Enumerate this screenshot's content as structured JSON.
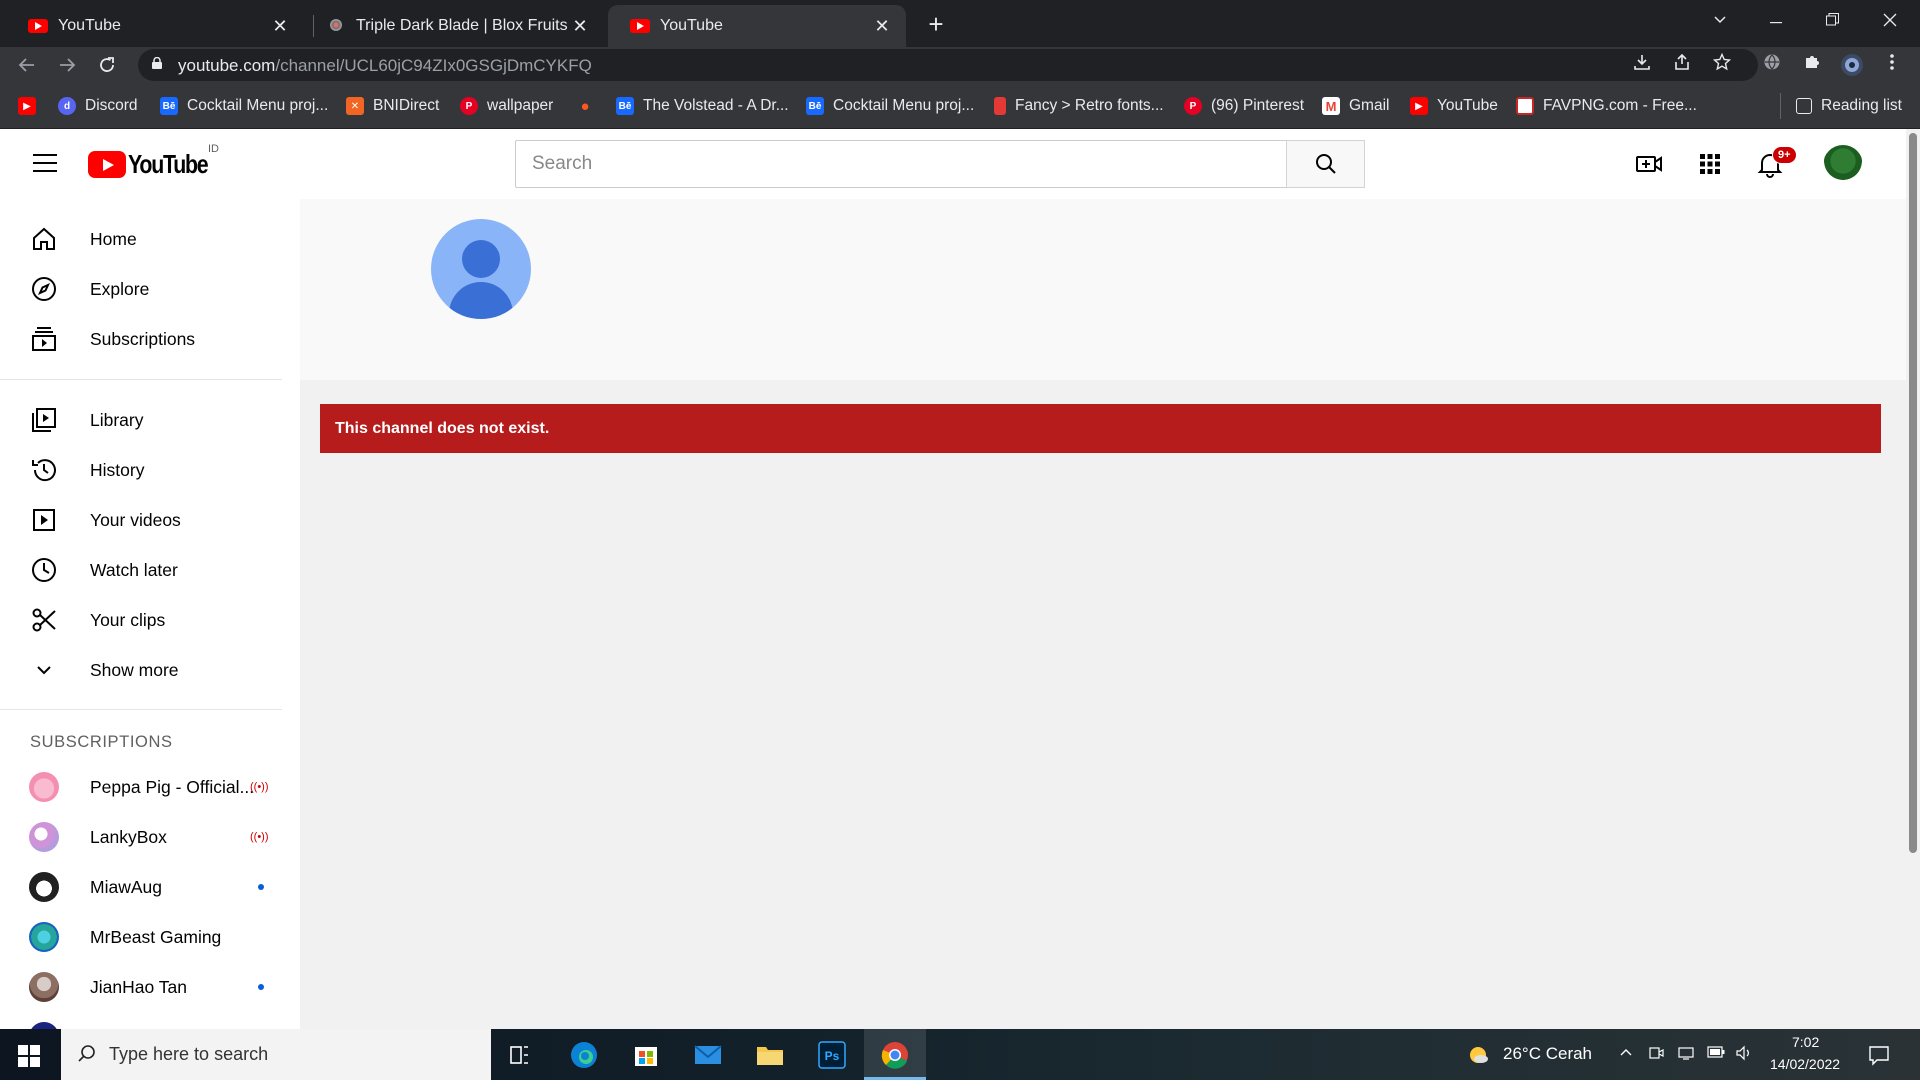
{
  "browser": {
    "tabs": [
      {
        "title": "YouTube",
        "icon": "youtube-icon"
      },
      {
        "title": "Triple Dark Blade | Blox Fruits Wiki",
        "icon": "wiki-icon"
      },
      {
        "title": "YouTube",
        "icon": "youtube-icon",
        "active": true
      }
    ],
    "url_host": "youtube.com",
    "url_path": "/channel/UCL60jC94ZIx0GSGjDmCYKFQ",
    "bookmarks": [
      {
        "label": "Discord",
        "icon": "discord-icon",
        "color": "#5865f2"
      },
      {
        "label": "Cocktail Menu proj...",
        "icon": "behance-icon",
        "color": "#1769ff"
      },
      {
        "label": "BNIDirect",
        "icon": "bni-icon",
        "color": "#f26522"
      },
      {
        "label": "wallpaper",
        "icon": "pinterest-icon",
        "color": "#e60023"
      },
      {
        "label": "The Volstead - A Dr...",
        "icon": "behance-icon",
        "color": "#1769ff"
      },
      {
        "label": "Cocktail Menu proj...",
        "icon": "behance-icon",
        "color": "#1769ff"
      },
      {
        "label": "Fancy > Retro fonts...",
        "icon": "dafont-icon",
        "color": "#e53935"
      },
      {
        "label": "(96) Pinterest",
        "icon": "pinterest-icon",
        "color": "#e60023"
      },
      {
        "label": "Gmail",
        "icon": "gmail-icon",
        "color": "#ea4335"
      },
      {
        "label": "YouTube",
        "icon": "youtube-icon",
        "color": "#ff0000"
      },
      {
        "label": "FAVPNG.com - Free...",
        "icon": "favpng-icon",
        "color": "#c62828"
      }
    ],
    "reading_list": "Reading list"
  },
  "youtube": {
    "logo_text": "YouTube",
    "country_code": "ID",
    "search_placeholder": "Search",
    "notification_count": "9+",
    "nav": [
      {
        "label": "Home",
        "icon": "home-icon"
      },
      {
        "label": "Explore",
        "icon": "compass-icon"
      },
      {
        "label": "Subscriptions",
        "icon": "subscriptions-icon"
      }
    ],
    "library": [
      {
        "label": "Library",
        "icon": "library-icon"
      },
      {
        "label": "History",
        "icon": "history-icon"
      },
      {
        "label": "Your videos",
        "icon": "your-videos-icon"
      },
      {
        "label": "Watch later",
        "icon": "clock-icon"
      },
      {
        "label": "Your clips",
        "icon": "scissors-icon"
      },
      {
        "label": "Show more",
        "icon": "chevron-down-icon"
      }
    ],
    "subscriptions_heading": "SUBSCRIPTIONS",
    "subscriptions": [
      {
        "name": "Peppa Pig - Official...",
        "status": "live",
        "avatar_color": "#f48fb1"
      },
      {
        "name": "LankyBox",
        "status": "live",
        "avatar_color": "#ce93d8"
      },
      {
        "name": "MiawAug",
        "status": "new",
        "avatar_color": "#212121"
      },
      {
        "name": "MrBeast Gaming",
        "status": "none",
        "avatar_color": "#26a69a"
      },
      {
        "name": "JianHao Tan",
        "status": "new",
        "avatar_color": "#8d6e63"
      }
    ],
    "error_message": "This channel does not exist.",
    "error_color": "#b71c1c"
  },
  "taskbar": {
    "search_placeholder": "Type here to search",
    "weather": "26°C  Cerah",
    "time": "7:02",
    "date": "14/02/2022"
  }
}
